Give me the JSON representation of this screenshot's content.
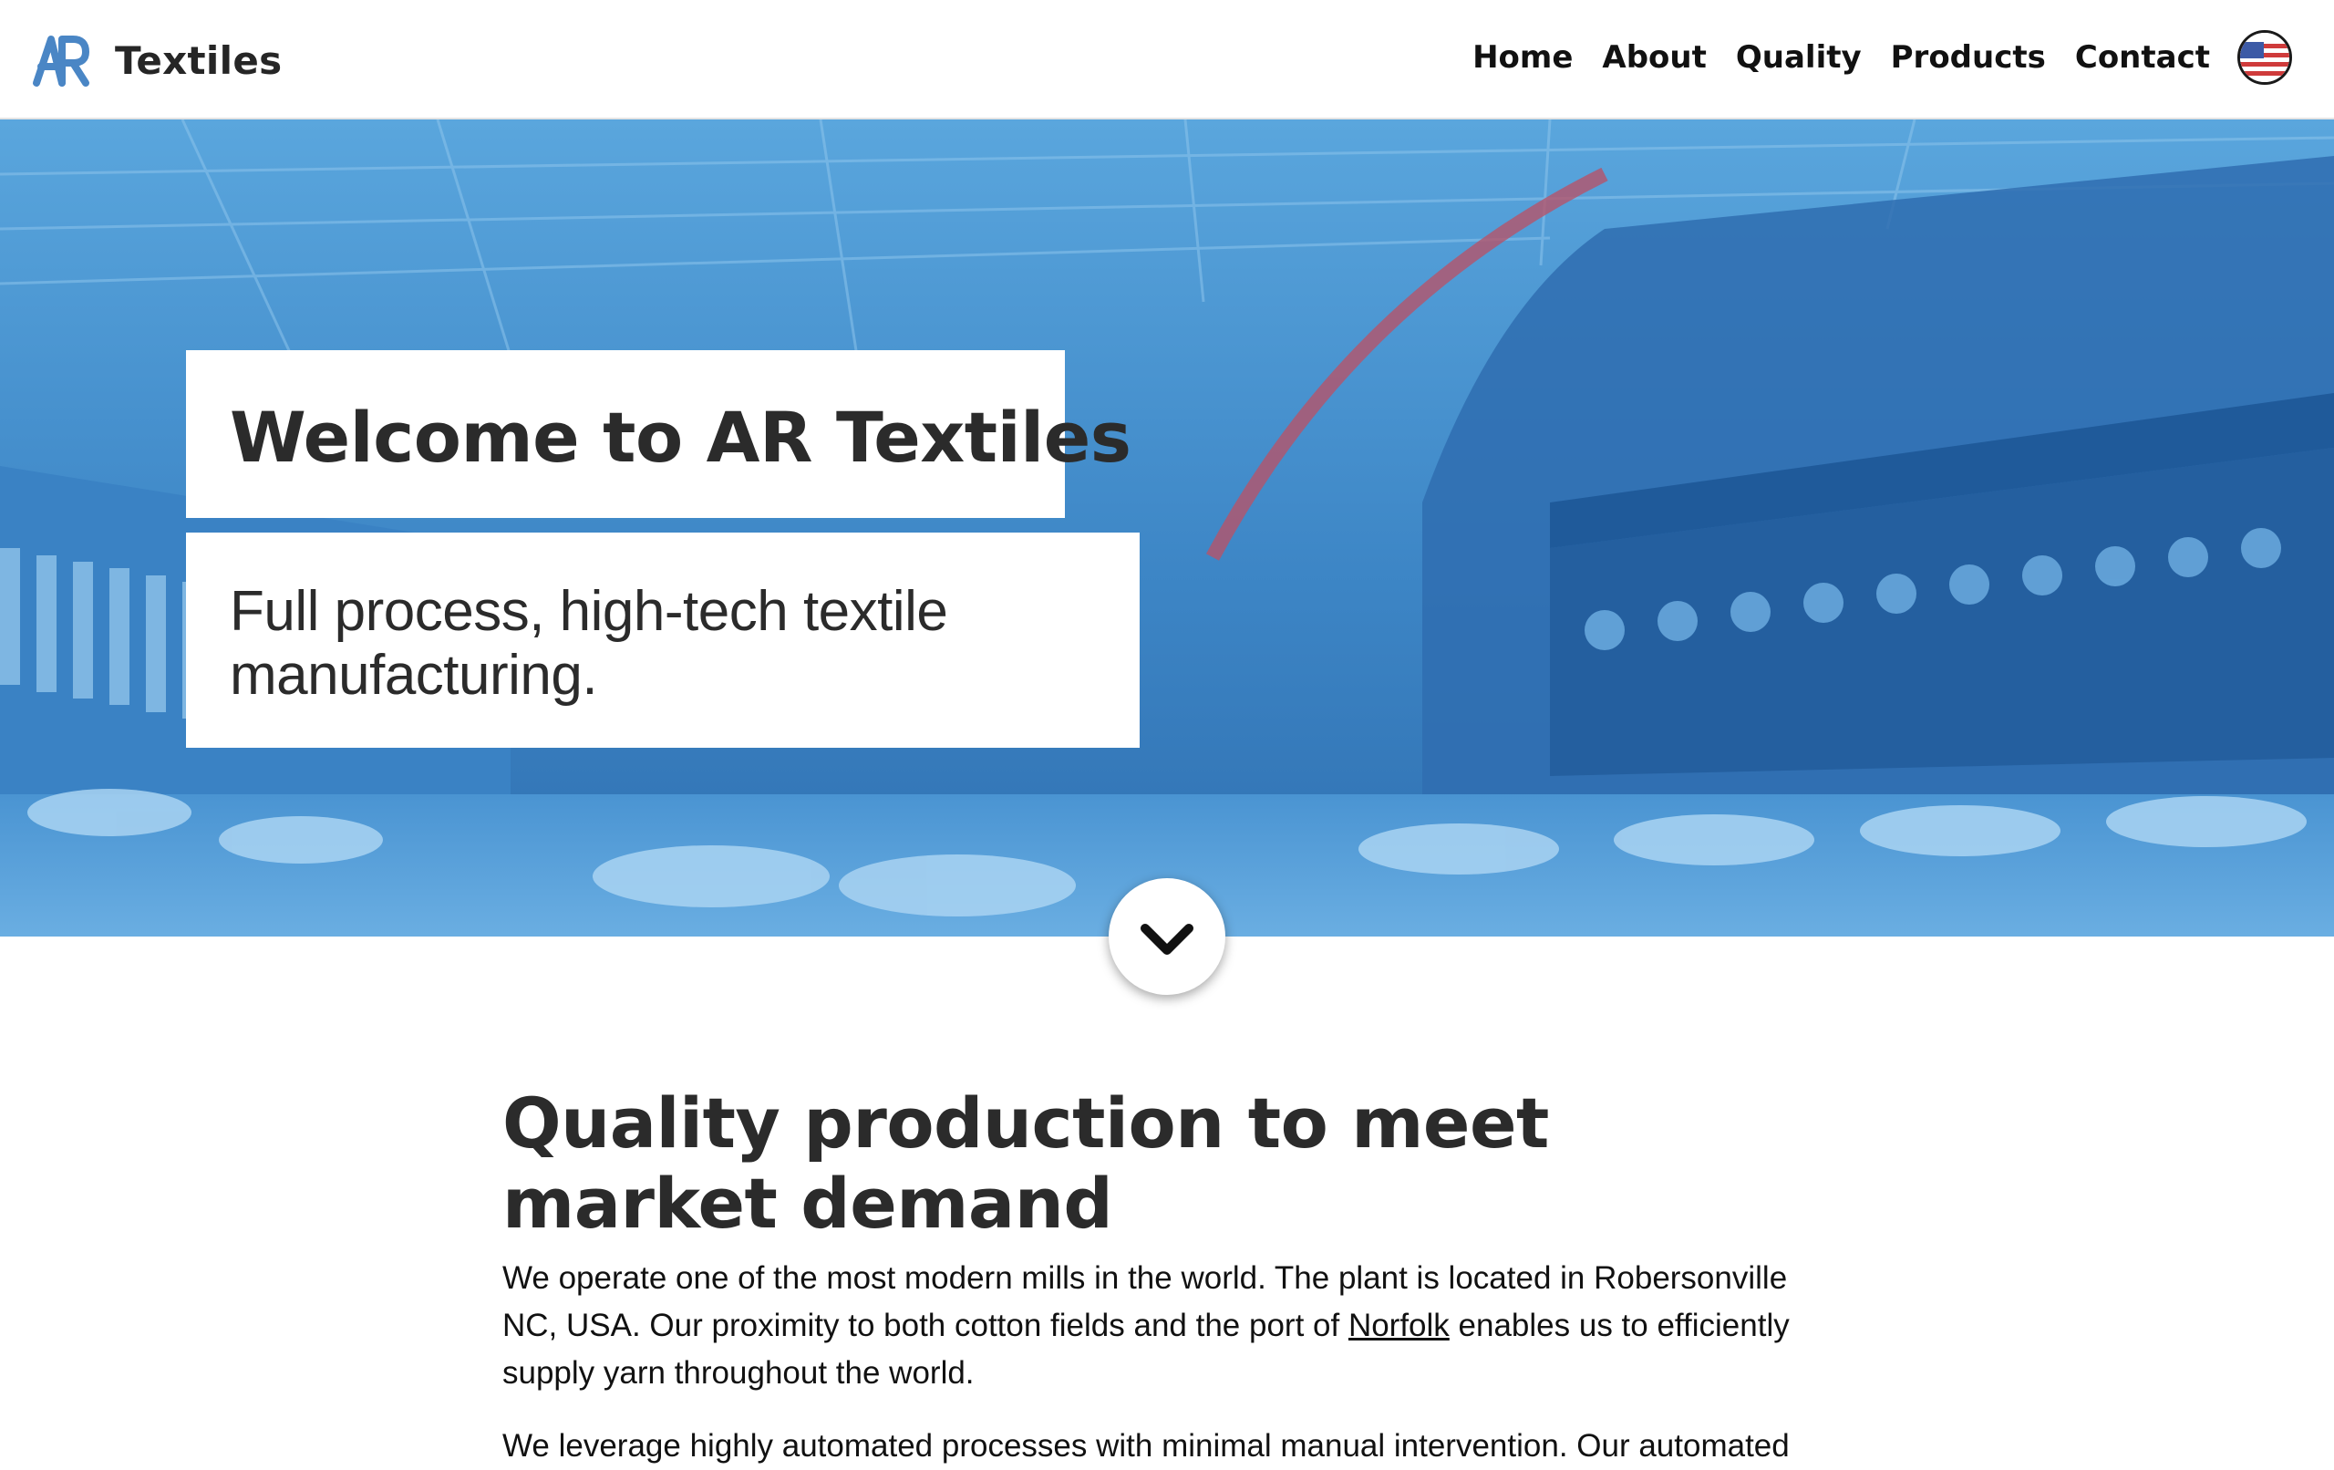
{
  "header": {
    "brand_name": "Textiles",
    "logo_text": "AR",
    "nav": [
      "Home",
      "About",
      "Quality",
      "Products",
      "Contact"
    ],
    "language_icon": "us-flag-icon"
  },
  "hero": {
    "title": "Welcome to AR Textiles",
    "subtitle": "Full process, high-tech textile manufacturing.",
    "scroll_icon": "chevron-down-icon"
  },
  "content": {
    "heading": "Quality production to meet market demand",
    "p1_before": "We operate one of the most modern mills in the world. The plant is located in Robersonville NC, USA. Our proximity to both cotton fields and the port of ",
    "p1_link": "Norfolk",
    "p1_after": " enables us to efficiently supply yarn throughout the world.",
    "p2": "We leverage highly automated processes with minimal manual intervention. Our automated"
  },
  "colors": {
    "brand_blue": "#4a86c5",
    "hero_overlay": "#3f8fd0",
    "text_dark": "#2b2b2b"
  }
}
